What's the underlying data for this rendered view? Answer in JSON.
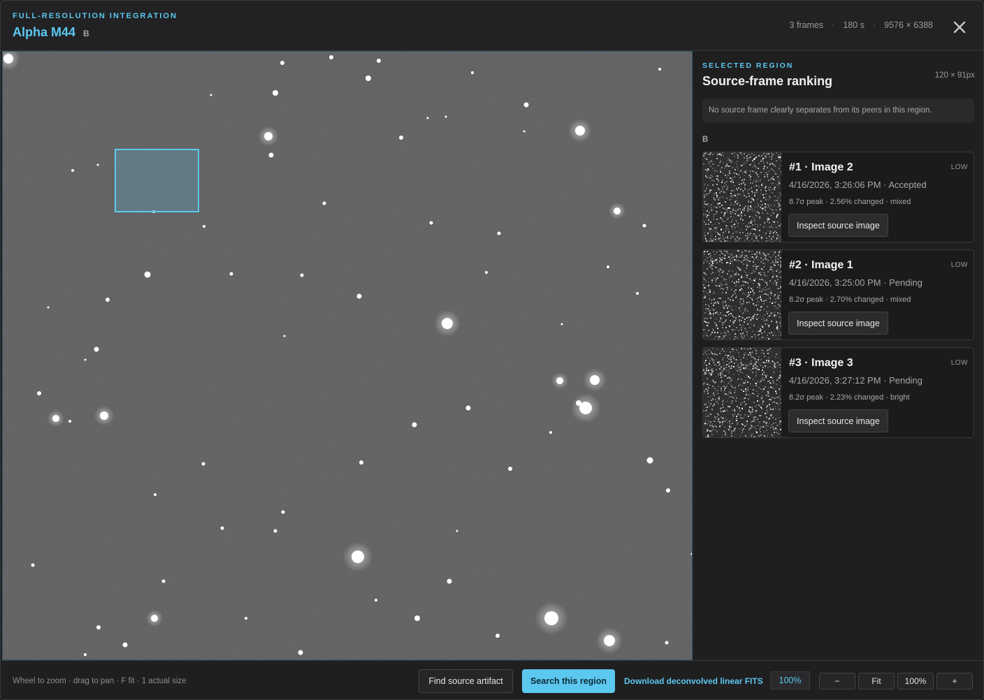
{
  "header": {
    "eyebrow": "FULL-RESOLUTION INTEGRATION",
    "title": "Alpha M44",
    "badge": "B",
    "meta": [
      "3 frames",
      "180 s",
      "9576 × 6388"
    ],
    "close_icon": "close-icon"
  },
  "sidebar": {
    "eyebrow": "SELECTED REGION",
    "title": "Source-frame ranking",
    "region_size": "120 × 91px",
    "notice": "No source frame clearly separates from its peers in this region.",
    "group_label": "B",
    "cards": [
      {
        "title": "#1 · Image 2",
        "badge": "LOW",
        "subtitle": "4/16/2026, 3:26:06 PM · Accepted",
        "stats": "8.7σ peak · 2.56% changed · mixed",
        "button": "Inspect source image"
      },
      {
        "title": "#2 · Image 1",
        "badge": "LOW",
        "subtitle": "4/16/2026, 3:25:00 PM · Pending",
        "stats": "8.2σ peak · 2.70% changed · mixed",
        "button": "Inspect source image"
      },
      {
        "title": "#3 · Image 3",
        "badge": "LOW",
        "subtitle": "4/16/2026, 3:27:12 PM · Pending",
        "stats": "8.2σ peak · 2.23% changed · bright",
        "button": "Inspect source image"
      }
    ]
  },
  "footer": {
    "hint": "Wheel to zoom · drag to pan · F fit · 1 actual size",
    "find_button": "Find source artifact",
    "search_button": "Search this region",
    "download_link": "Download deconvolved linear FITS",
    "zoom_readout": "100%",
    "zoom_out": "−",
    "fit": "Fit",
    "actual": "100%",
    "zoom_in": "+"
  },
  "colors": {
    "accent": "#5cc8f0",
    "background": "#1f1f20",
    "sky": "#3a3a3a"
  }
}
